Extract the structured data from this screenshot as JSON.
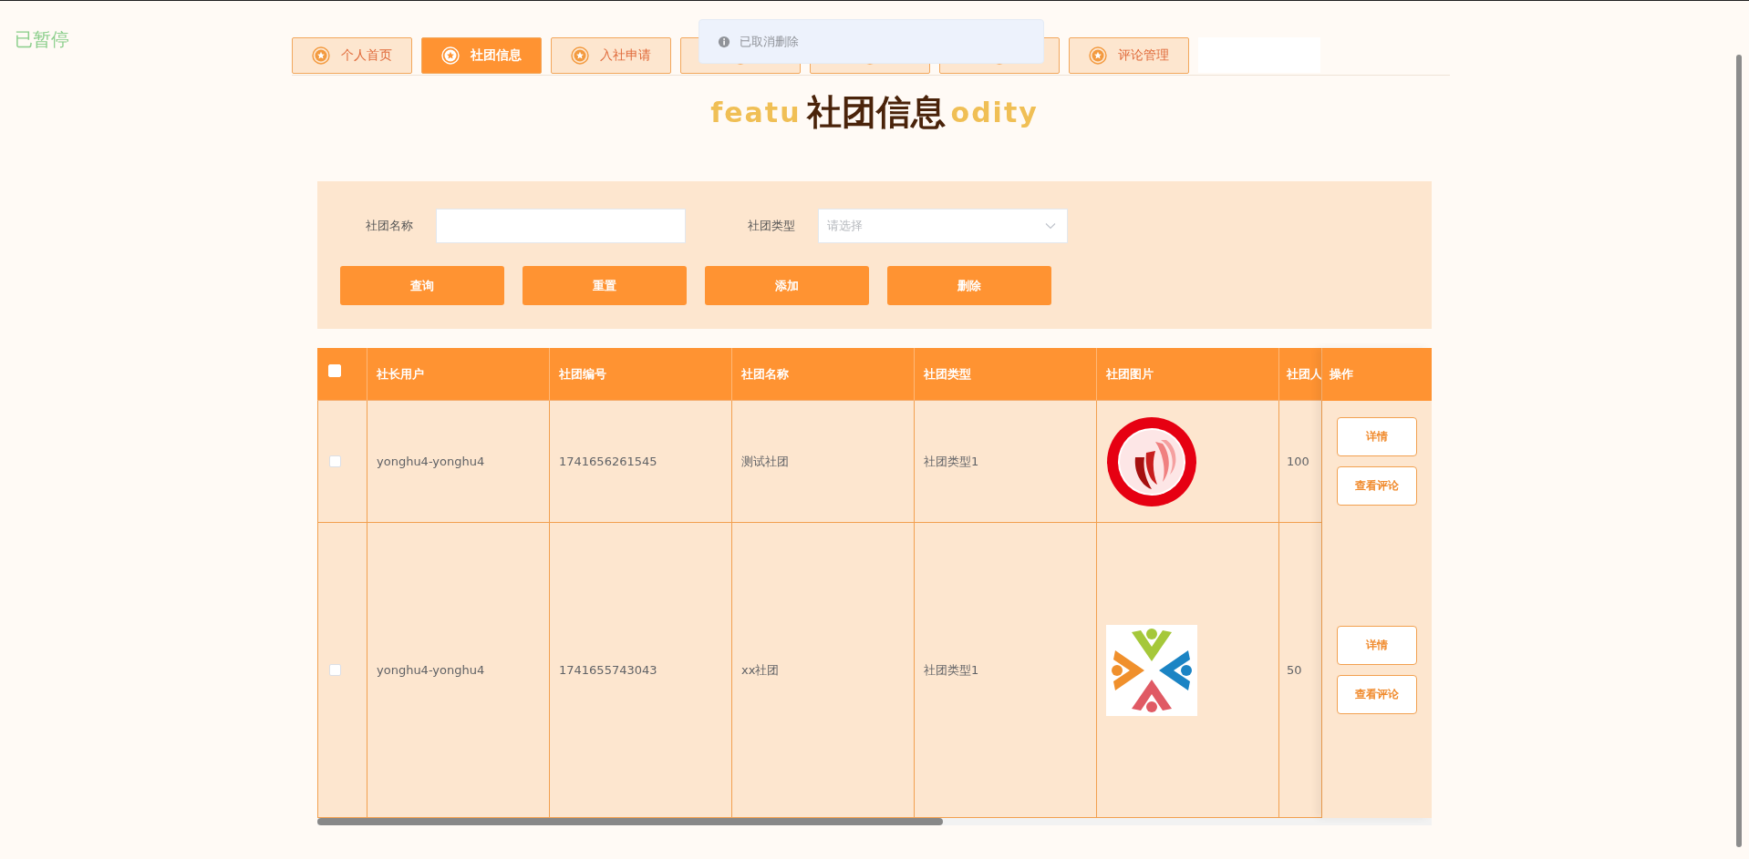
{
  "overlay_status": "已暂停",
  "tabs": [
    {
      "label": "个人首页",
      "selected": false
    },
    {
      "label": "社团信息",
      "selected": true
    },
    {
      "label": "入社申请",
      "selected": false
    },
    {
      "selected": false
    },
    {
      "selected": false
    },
    {
      "selected": false
    },
    {
      "label": "评论管理",
      "selected": false
    }
  ],
  "toast": {
    "message": "已取消删除"
  },
  "heading": {
    "title": "社团信息",
    "backdrop_left": "featu",
    "backdrop_right": "odity"
  },
  "filters": [
    {
      "label": "社团名称",
      "kind": "input"
    },
    {
      "label": "社团类型",
      "kind": "select",
      "placeholder": "请选择"
    }
  ],
  "buttons": [
    "查询",
    "重置",
    "添加",
    "删除"
  ],
  "table": {
    "select_all": {
      "checked": false
    },
    "columns": [
      "社长用户",
      "社团编号",
      "社团名称",
      "社团类型",
      "社团图片",
      "社团人"
    ],
    "action_column": "操作",
    "rows": [
      {
        "checked": false,
        "cells": [
          "yonghu4-yonghu4",
          "1741656261545",
          "测试社团",
          "社团类型1"
        ],
        "count": "100",
        "actions": [
          "详情",
          "查看评论"
        ]
      },
      {
        "checked": false,
        "cells": [
          "yonghu4-yonghu4",
          "1741655743043",
          "xx社团",
          "社团类型1"
        ],
        "count": "50",
        "actions": [
          "详情",
          "查看评论"
        ]
      }
    ]
  }
}
